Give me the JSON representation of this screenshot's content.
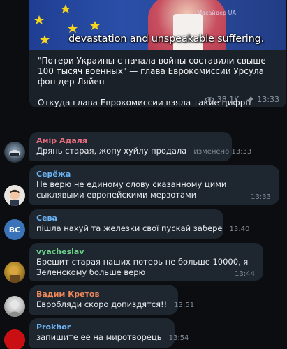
{
  "post": {
    "watermark": "Масайдер UA",
    "subtitle": "devastation and unspeakable suffering.",
    "text": "\"Потери Украины с начала войны составили свыше 100 тысяч военных\" — глава Еврокомиссии Урсула фон дер Ляйен",
    "comment_text": "Откуда глава Еврокомиссии взяла такие цифры — неизвестно.",
    "views": "38.1K",
    "time": "13:33"
  },
  "comments": [
    {
      "name": "Амір Адаля",
      "name_color": "#e66b7c",
      "text": "Дрянь старая, жопу хуйлу продала",
      "time": "изменено 13:33",
      "avatar": "helmet-photo"
    },
    {
      "name": "Серёжа",
      "name_color": "#6cb4f5",
      "text": "Не верю не единому слову сказанному цими сыклявыми европейскими мерзотами",
      "time": "13:33",
      "avatar": "character-photo"
    },
    {
      "name": "Сева",
      "name_color": "#6cb4f5",
      "text": "пішла нахуй та железки свої пускай забере",
      "time": "13:40",
      "avatar_initials": "ВС",
      "avatar_color": "#3a73b8"
    },
    {
      "name": "vyacheslav",
      "name_color": "#6cd48a",
      "text": "Брешит старая наших потерь не больше 10000, я Зеленскому больше верю",
      "time": "13:44",
      "avatar": "yellow-photo"
    },
    {
      "name": "Вадим Кретов",
      "name_color": "#f0885a",
      "text": "Евробляди скоро допиздятся!!",
      "time": "13:51",
      "avatar": "grey-photo"
    },
    {
      "name": "Prokhor",
      "name_color": "#6cb4f5",
      "text": "запишите её на миротворець",
      "time": "13:54",
      "avatar": "red-photo"
    }
  ]
}
